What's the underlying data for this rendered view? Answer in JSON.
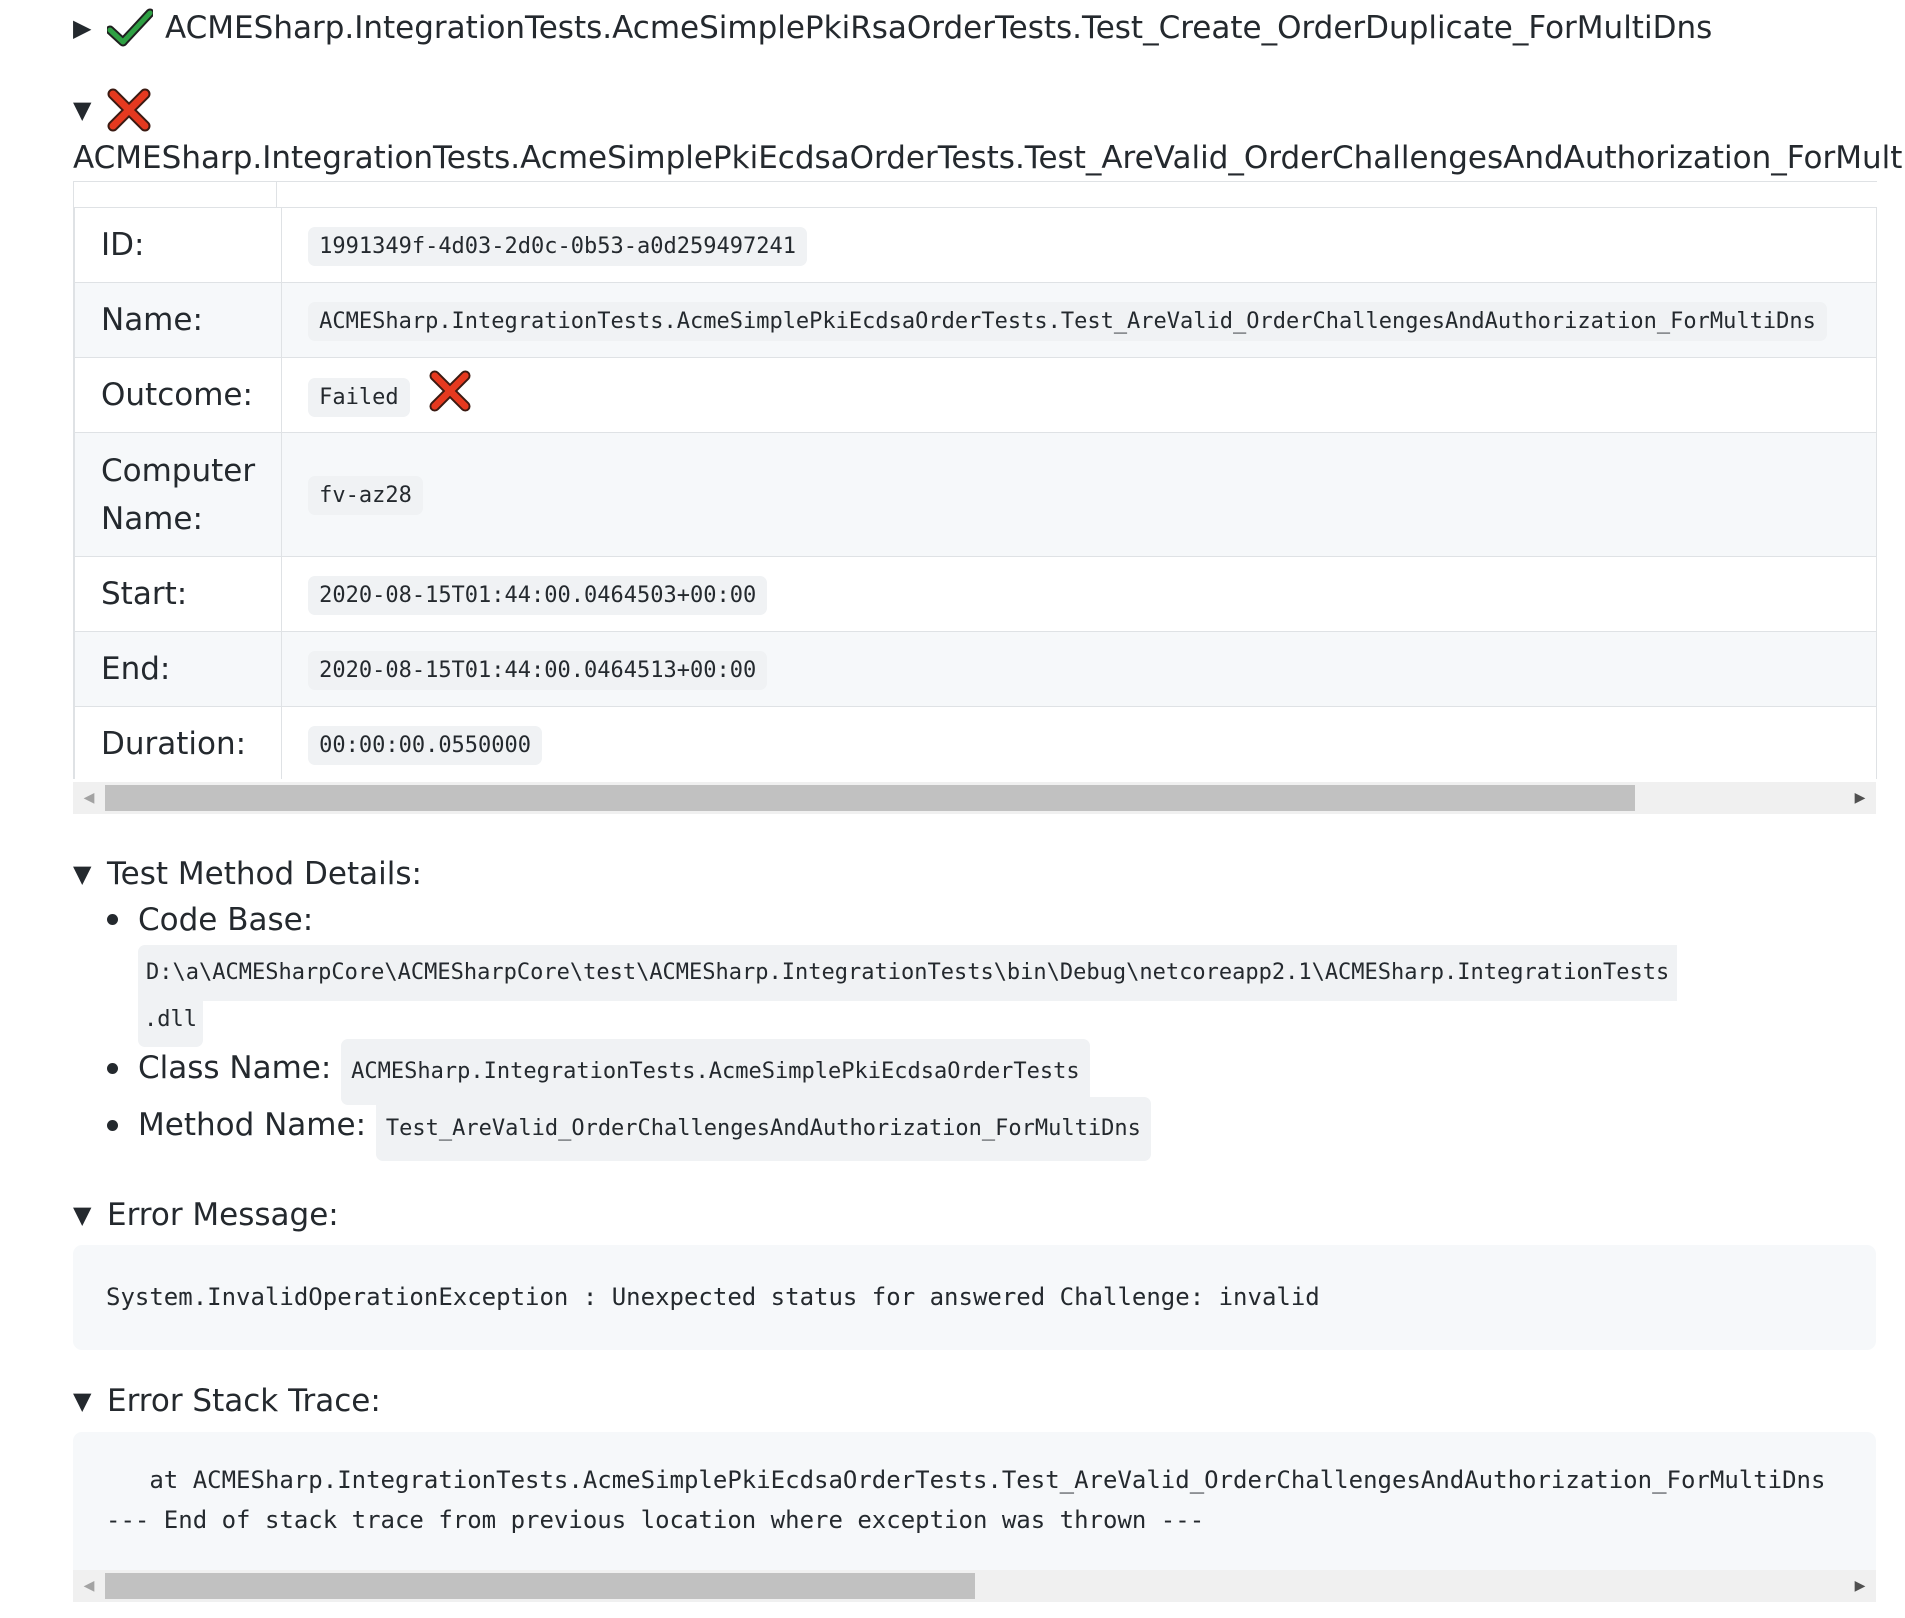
{
  "tests": [
    {
      "name": "ACMESharp.IntegrationTests.AcmeSimplePkiRsaOrderTests.Test_Create_OrderDuplicate_ForMultiDns",
      "expanded": false,
      "status_icon": "check-icon"
    },
    {
      "name": "ACMESharp.IntegrationTests.AcmeSimplePkiEcdsaOrderTests.Test_AreValid_OrderChallengesAndAuthorization_ForMultiDns",
      "expanded": true,
      "status_icon": "cross-icon"
    }
  ],
  "details_table": {
    "rows": [
      {
        "label": "ID:",
        "value": "1991349f-4d03-2d0c-0b53-a0d259497241"
      },
      {
        "label": "Name:",
        "value": "ACMESharp.IntegrationTests.AcmeSimplePkiEcdsaOrderTests.Test_AreValid_OrderChallengesAndAuthorization_ForMultiDns"
      },
      {
        "label": "Outcome:",
        "value": "Failed"
      },
      {
        "label": "Computer Name:",
        "value": "fv-az28"
      },
      {
        "label": "Start:",
        "value": "2020-08-15T01:44:00.0464503+00:00"
      },
      {
        "label": "End:",
        "value": "2020-08-15T01:44:00.0464513+00:00"
      },
      {
        "label": "Duration:",
        "value": "00:00:00.0550000"
      }
    ],
    "scroll_position": 0.0,
    "scroll_visible_fraction": 0.88
  },
  "test_method_details": {
    "title": "Test Method Details:",
    "items": [
      {
        "label": "Code Base:",
        "value": "D:\\a\\ACMESharpCore\\ACMESharpCore\\test\\ACMESharp.IntegrationTests\\bin\\Debug\\netcoreapp2.1\\ACMESharp.IntegrationTests",
        "value_cont": ".dll"
      },
      {
        "label": "Class Name:",
        "value": "ACMESharp.IntegrationTests.AcmeSimplePkiEcdsaOrderTests"
      },
      {
        "label": "Method Name:",
        "value": "Test_AreValid_OrderChallengesAndAuthorization_ForMultiDns"
      }
    ]
  },
  "error_message": {
    "title": "Error Message:",
    "text": "System.InvalidOperationException : Unexpected status for answered Challenge: invalid"
  },
  "error_stack_trace": {
    "title": "Error Stack Trace:",
    "lines": [
      "   at ACMESharp.IntegrationTests.AcmeSimplePkiEcdsaOrderTests.Test_AreValid_OrderChallengesAndAuthorization_ForMultiDns",
      "--- End of stack trace from previous location where exception was thrown ---"
    ],
    "scroll_position": 0.0,
    "scroll_visible_fraction": 0.5
  },
  "colors": {
    "pass": "#2ea043",
    "fail": "#e5391f",
    "code_bg": "#f0f2f4",
    "table_stripe": "#f6f8fa",
    "border": "#dfe2e5"
  }
}
